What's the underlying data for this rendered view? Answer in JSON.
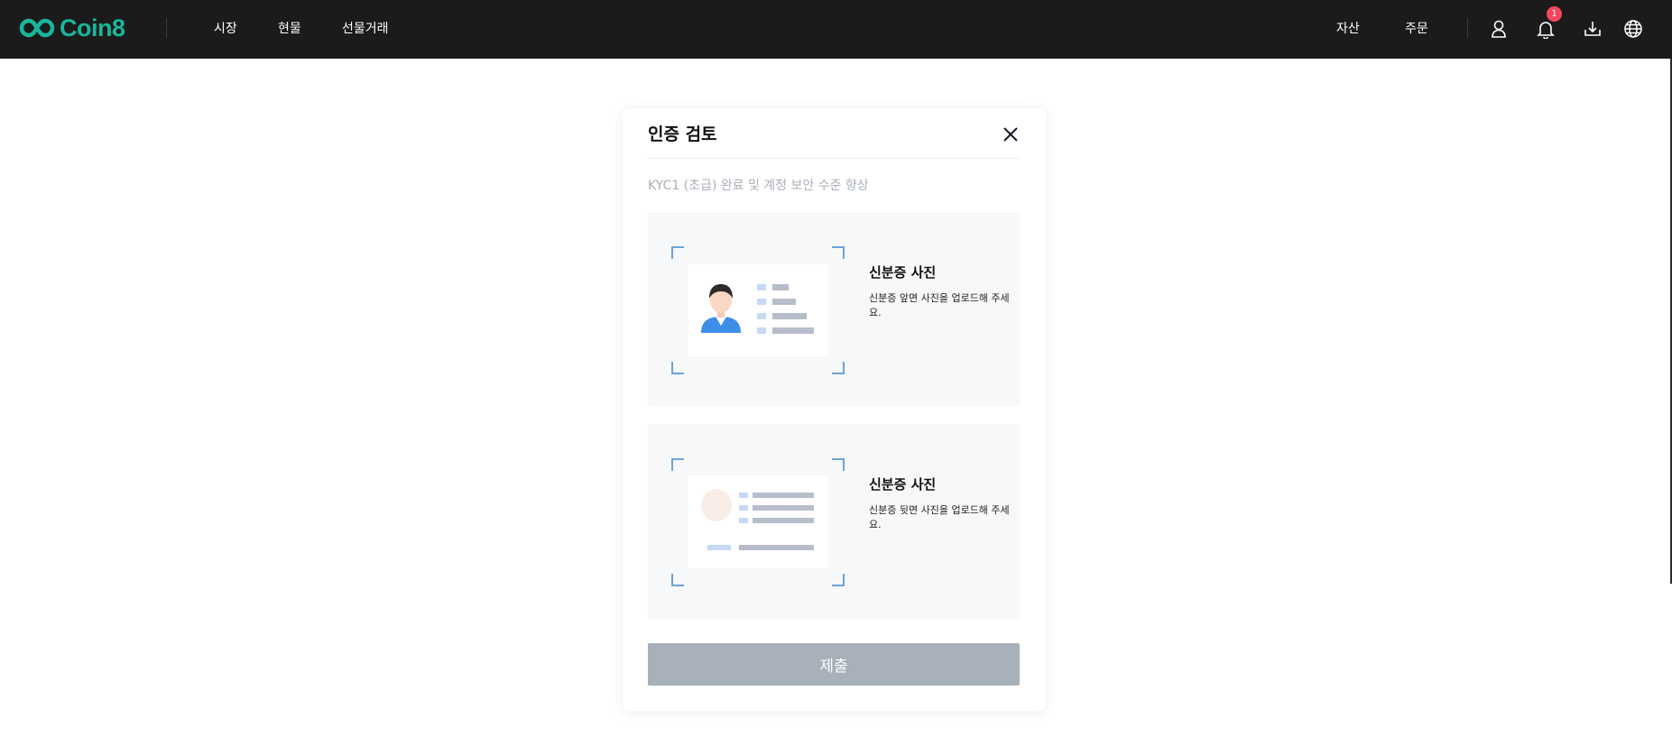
{
  "brand": {
    "name": "Coin8",
    "color": "#19b69a"
  },
  "nav": {
    "items": [
      {
        "label": "시장"
      },
      {
        "label": "현물"
      },
      {
        "label": "선물거래"
      }
    ]
  },
  "header_right": {
    "assets_label": "자산",
    "orders_label": "주문",
    "notification_count": "1",
    "icons": [
      "user-icon",
      "bell-icon",
      "download-icon",
      "globe-icon"
    ]
  },
  "modal": {
    "title": "인증 검토",
    "subtitle": "KYC1 (초급) 완료 및 계정 보안 수준 향상",
    "cards": [
      {
        "title": "신분증 사진",
        "description": "신분증 앞면 사진을 업로드해 주세요.",
        "illustration": "id-card-front"
      },
      {
        "title": "신분증 사진",
        "description": "신분증 뒷면 사진을 업로드해 주세요.",
        "illustration": "id-card-back"
      }
    ],
    "submit_label": "제출"
  },
  "colors": {
    "header_bg": "#1b1b1b",
    "submit_disabled": "#a8b0b9",
    "badge": "#f5465d",
    "frame_corner": "#6aa3d8"
  }
}
